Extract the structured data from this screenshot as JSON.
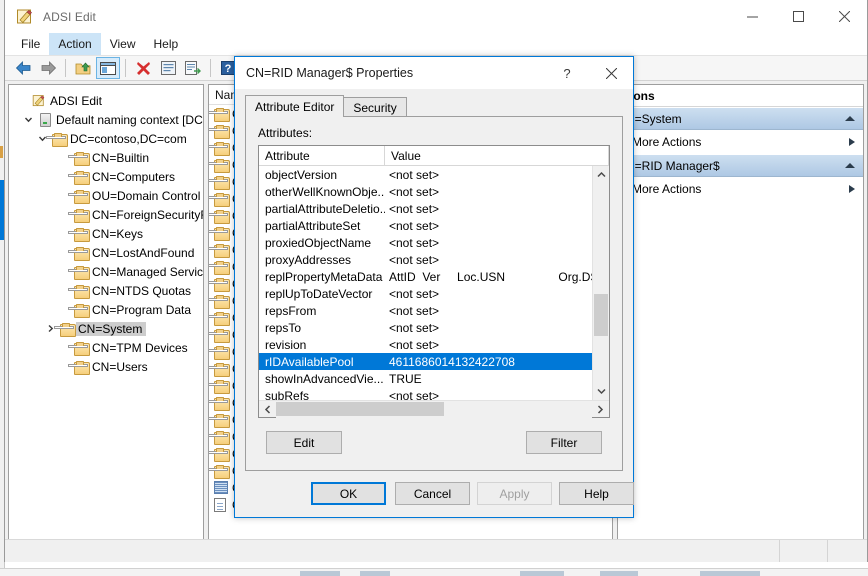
{
  "window": {
    "title": "ADSI Edit",
    "icon": "adsi-edit-icon",
    "minimize_label": "—",
    "maximize_label": "□",
    "close_label": "✕"
  },
  "menubar": {
    "items": [
      {
        "label": "File",
        "active": false
      },
      {
        "label": "Action",
        "active": true
      },
      {
        "label": "View",
        "active": false
      },
      {
        "label": "Help",
        "active": false
      }
    ]
  },
  "toolbar": {
    "buttons": [
      {
        "name": "back-icon",
        "selected": false
      },
      {
        "name": "forward-icon",
        "selected": false
      },
      {
        "name": "separator",
        "selected": false
      },
      {
        "name": "up-folder-icon",
        "selected": false
      },
      {
        "name": "show-hide-console-tree-icon",
        "selected": true
      },
      {
        "name": "separator",
        "selected": false
      },
      {
        "name": "delete-icon",
        "selected": false
      },
      {
        "name": "properties-icon",
        "selected": false
      },
      {
        "name": "export-list-icon",
        "selected": false
      },
      {
        "name": "separator",
        "selected": false
      },
      {
        "name": "help-icon",
        "selected": false
      },
      {
        "name": "show-hide-action-pane-icon",
        "selected": true
      }
    ]
  },
  "tree": {
    "nodes": [
      {
        "label": "ADSI Edit",
        "indent": 0,
        "twist": "",
        "icon": "adsi-edit-icon",
        "selected": false
      },
      {
        "label": "Default naming context [DC",
        "indent": 1,
        "twist": "down",
        "icon": "server-icon",
        "selected": false
      },
      {
        "label": "DC=contoso,DC=com",
        "indent": 2,
        "twist": "down",
        "icon": "folder-icon",
        "selected": false
      },
      {
        "label": "CN=Builtin",
        "indent": 3,
        "twist": "",
        "icon": "folder-icon",
        "selected": false
      },
      {
        "label": "CN=Computers",
        "indent": 3,
        "twist": "",
        "icon": "folder-icon",
        "selected": false
      },
      {
        "label": "OU=Domain Control",
        "indent": 3,
        "twist": "",
        "icon": "folder-icon",
        "selected": false
      },
      {
        "label": "CN=ForeignSecurityF",
        "indent": 3,
        "twist": "",
        "icon": "folder-icon",
        "selected": false
      },
      {
        "label": "CN=Keys",
        "indent": 3,
        "twist": "",
        "icon": "folder-icon",
        "selected": false
      },
      {
        "label": "CN=LostAndFound",
        "indent": 3,
        "twist": "",
        "icon": "folder-icon",
        "selected": false
      },
      {
        "label": "CN=Managed Servic",
        "indent": 3,
        "twist": "",
        "icon": "folder-icon",
        "selected": false
      },
      {
        "label": "CN=NTDS Quotas",
        "indent": 3,
        "twist": "",
        "icon": "folder-icon",
        "selected": false
      },
      {
        "label": "CN=Program Data",
        "indent": 3,
        "twist": "",
        "icon": "folder-icon",
        "selected": false
      },
      {
        "label": "CN=System",
        "indent": 3,
        "twist": "right",
        "icon": "folder-icon",
        "selected": true
      },
      {
        "label": "CN=TPM Devices",
        "indent": 3,
        "twist": "",
        "icon": "folder-icon",
        "selected": false
      },
      {
        "label": "CN=Users",
        "indent": 3,
        "twist": "",
        "icon": "folder-icon",
        "selected": false
      }
    ]
  },
  "list": {
    "column_header": "Nam",
    "rows": [
      {
        "icon": "folder-icon",
        "label": "C"
      },
      {
        "icon": "folder-icon",
        "label": "C"
      },
      {
        "icon": "folder-icon",
        "label": "C"
      },
      {
        "icon": "folder-icon",
        "label": "C"
      },
      {
        "icon": "folder-icon",
        "label": "C"
      },
      {
        "icon": "folder-icon",
        "label": "C"
      },
      {
        "icon": "folder-icon",
        "label": "C"
      },
      {
        "icon": "folder-icon",
        "label": "C"
      },
      {
        "icon": "folder-icon",
        "label": "C"
      },
      {
        "icon": "folder-icon",
        "label": "C"
      },
      {
        "icon": "folder-icon",
        "label": "C"
      },
      {
        "icon": "folder-icon",
        "label": "C"
      },
      {
        "icon": "folder-icon",
        "label": "C"
      },
      {
        "icon": "folder-icon",
        "label": "C"
      },
      {
        "icon": "folder-icon",
        "label": "C"
      },
      {
        "icon": "folder-icon",
        "label": "C"
      },
      {
        "icon": "folder-icon",
        "label": "C"
      },
      {
        "icon": "folder-icon",
        "label": "C"
      },
      {
        "icon": "folder-icon",
        "label": "C"
      },
      {
        "icon": "folder-icon",
        "label": "C"
      },
      {
        "icon": "folder-icon",
        "label": "C"
      },
      {
        "icon": "folder-icon",
        "label": "C"
      },
      {
        "icon": "container-icon",
        "label": "C"
      },
      {
        "icon": "note-icon",
        "label": "C"
      }
    ]
  },
  "actions": {
    "title": "tions",
    "groups": [
      {
        "header": "N=System",
        "items": [
          {
            "label": "More Actions",
            "has_submenu": true
          }
        ]
      },
      {
        "header": "N=RID Manager$",
        "items": [
          {
            "label": "More Actions",
            "has_submenu": true
          }
        ]
      }
    ]
  },
  "dialog": {
    "title": "CN=RID Manager$ Properties",
    "help_label": "?",
    "close_label": "✕",
    "tabs": [
      {
        "label": "Attribute Editor",
        "active": true
      },
      {
        "label": "Security",
        "active": false
      }
    ],
    "attributes_label": "Attributes:",
    "columns": [
      "Attribute",
      "Value"
    ],
    "rows": [
      {
        "attribute": "objectVersion",
        "value": "<not set>",
        "selected": false
      },
      {
        "attribute": "otherWellKnownObje...",
        "value": "<not set>",
        "selected": false
      },
      {
        "attribute": "partialAttributeDeletio...",
        "value": "<not set>",
        "selected": false
      },
      {
        "attribute": "partialAttributeSet",
        "value": "<not set>",
        "selected": false
      },
      {
        "attribute": "proxiedObjectName",
        "value": "<not set>",
        "selected": false
      },
      {
        "attribute": "proxyAddresses",
        "value": "<not set>",
        "selected": false
      },
      {
        "attribute": "replPropertyMetaData",
        "value": "AttID  Ver     Loc.USN                Org.DSA",
        "selected": false
      },
      {
        "attribute": "replUpToDateVector",
        "value": "<not set>",
        "selected": false
      },
      {
        "attribute": "repsFrom",
        "value": "<not set>",
        "selected": false
      },
      {
        "attribute": "repsTo",
        "value": "<not set>",
        "selected": false
      },
      {
        "attribute": "revision",
        "value": "<not set>",
        "selected": false
      },
      {
        "attribute": "rIDAvailablePool",
        "value": "4611686014132422708",
        "selected": true
      },
      {
        "attribute": "showInAdvancedVie...",
        "value": "TRUE",
        "selected": false
      },
      {
        "attribute": "subRefs",
        "value": "<not set>",
        "selected": false
      }
    ],
    "edit_button": "Edit",
    "filter_button": "Filter",
    "footer_buttons": [
      {
        "label": "OK",
        "style": "default"
      },
      {
        "label": "Cancel",
        "style": "normal"
      },
      {
        "label": "Apply",
        "style": "disabled"
      },
      {
        "label": "Help",
        "style": "normal"
      }
    ]
  },
  "colors": {
    "selection_blue": "#0078d7",
    "accent_header": "#aec8e4",
    "tree_selection": "#cdcdcd"
  }
}
